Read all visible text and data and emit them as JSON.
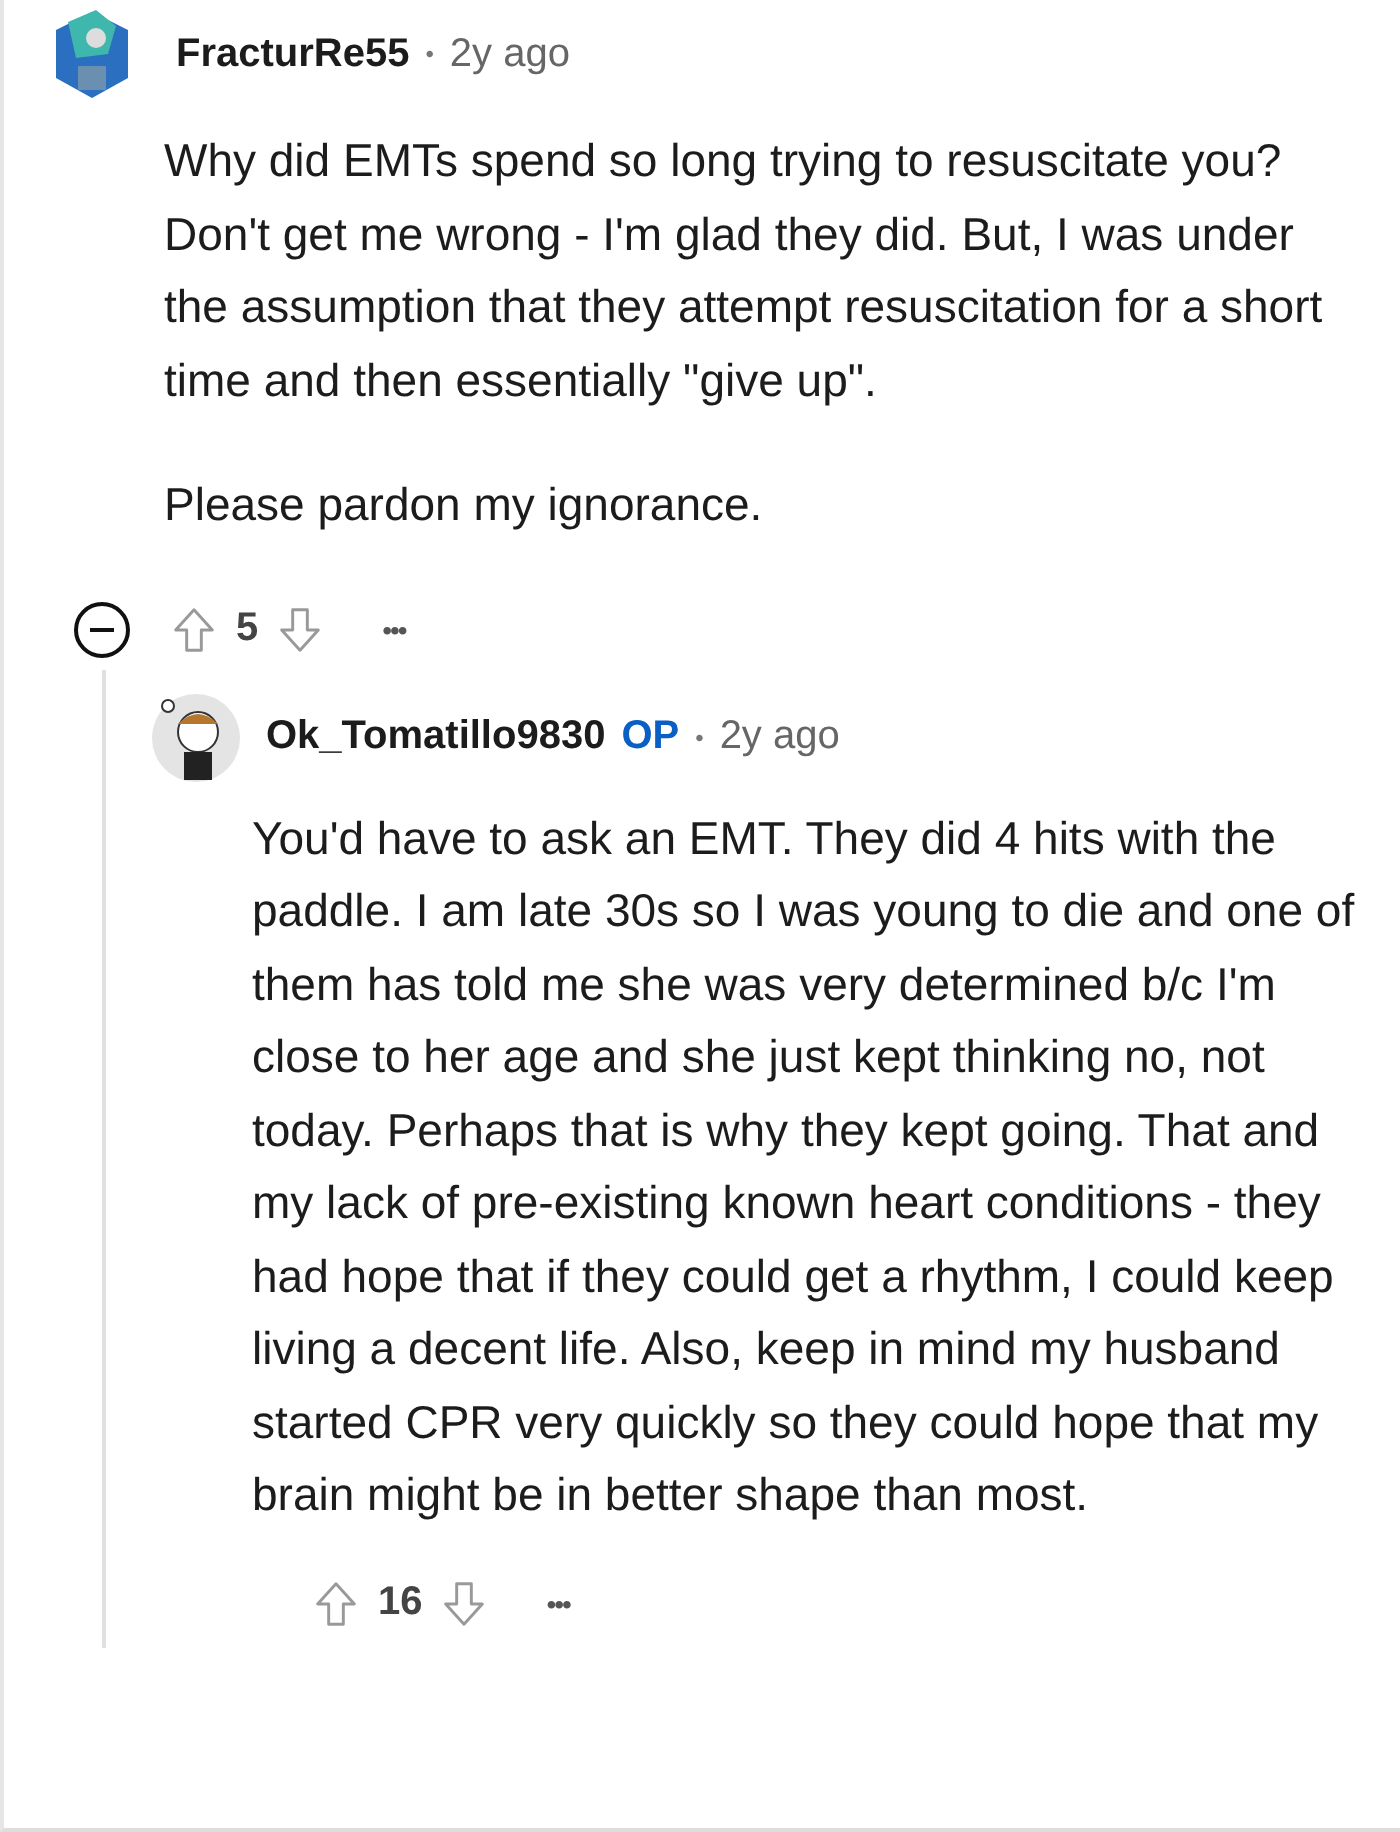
{
  "comment": {
    "author": "FracturRe55",
    "separator": "•",
    "time": "2y ago",
    "paragraphs": [
      "Why did EMTs spend so long trying to resuscitate you? Don't get me wrong - I'm glad they did. But, I was under the assumption that they attempt resuscitation for a short time and then essentially \"give up\".",
      "Please pardon my ignorance."
    ],
    "expanded": true,
    "votes": "5",
    "more": "•••",
    "reply": {
      "author": "Ok_Tomatillo9830",
      "badge": "OP",
      "separator": "•",
      "time": "2y ago",
      "paragraphs": [
        "You'd have to ask an EMT. They did 4 hits with the paddle. I am late 30s so I was young to die and one of them has told me she was very determined b/c I'm close to her age and she just kept thinking no, not today. Perhaps that is why they kept going. That and my lack of pre-existing known heart conditions - they had hope that if they could get a rhythm, I could keep living a decent life. Also, keep in mind my husband started CPR very quickly so they could hope that my brain might be in better shape than most."
      ],
      "votes": "16",
      "more": "•••"
    }
  }
}
